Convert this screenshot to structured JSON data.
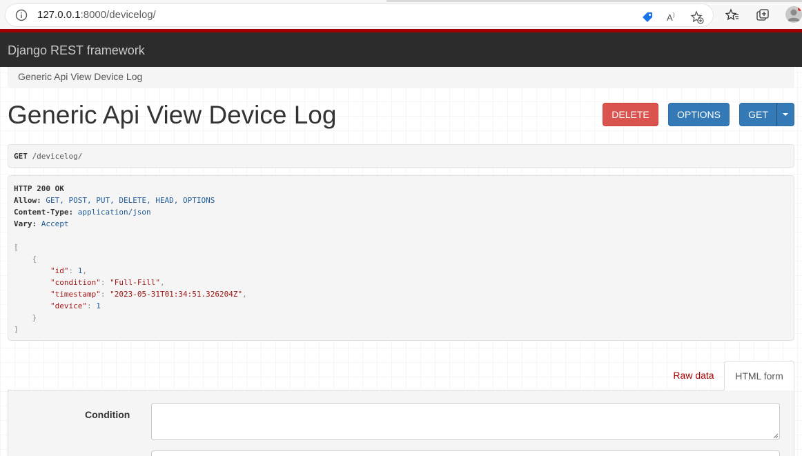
{
  "browser": {
    "url_host": "127.0.0.1",
    "url_rest": ":8000/devicelog/"
  },
  "navbar": {
    "brand": "Django REST framework"
  },
  "breadcrumb": {
    "item": "Generic Api View Device Log"
  },
  "page": {
    "title": "Generic Api View Device Log"
  },
  "buttons": {
    "delete": "DELETE",
    "options": "OPTIONS",
    "get": "GET"
  },
  "request": {
    "method": "GET",
    "path": "/devicelog/"
  },
  "response": {
    "status": "HTTP 200 OK",
    "headers": [
      {
        "name": "Allow:",
        "value": "GET, POST, PUT, DELETE, HEAD, OPTIONS"
      },
      {
        "name": "Content-Type:",
        "value": "application/json"
      },
      {
        "name": "Vary:",
        "value": "Accept"
      }
    ],
    "body": {
      "id": "1",
      "condition": "\"Full-Fill\"",
      "timestamp": "\"2023-05-31T01:34:51.326204Z\"",
      "device": "1"
    }
  },
  "tabs": {
    "raw": "Raw data",
    "html": "HTML form"
  },
  "form": {
    "condition_label": "Condition",
    "condition_value": ""
  },
  "colors": {
    "navbar": "#2c2c2c",
    "navbar_accent": "#a30000",
    "delete": "#d9534f",
    "primary": "#337ab7"
  }
}
